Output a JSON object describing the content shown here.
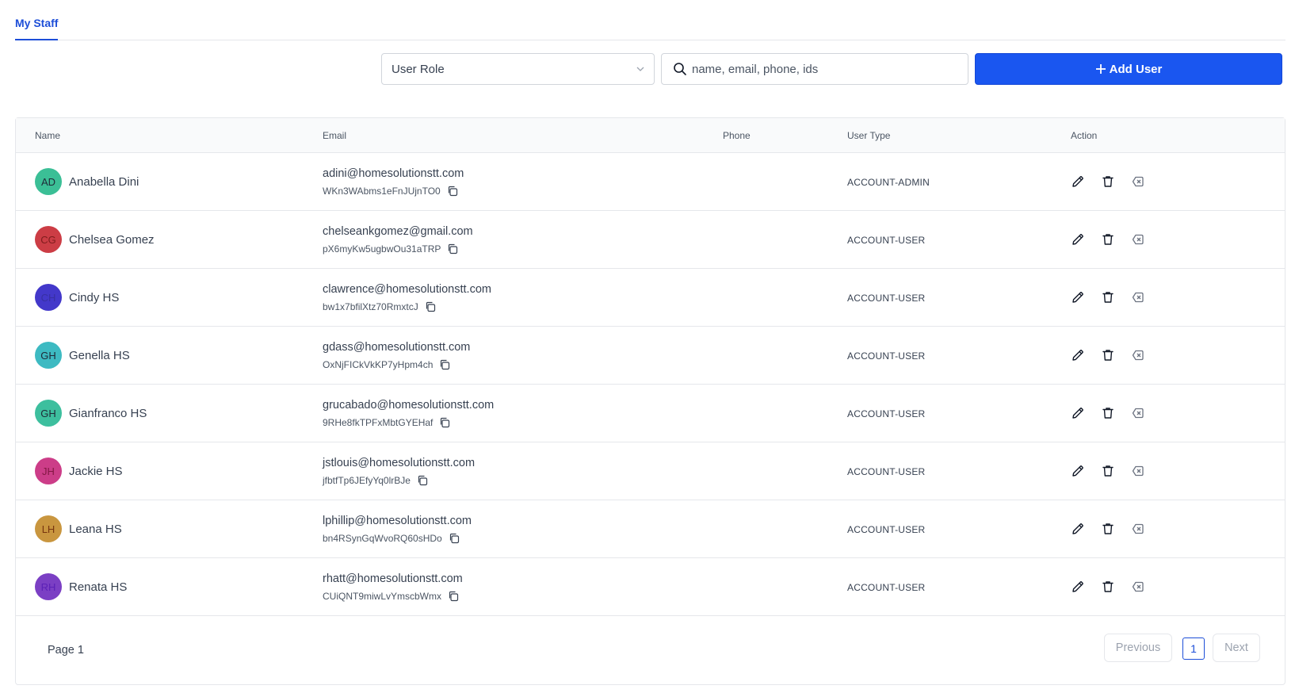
{
  "tabs": [
    {
      "label": "My Staff"
    }
  ],
  "filters": {
    "role_select": {
      "value": "User Role"
    },
    "search": {
      "placeholder": "name, email, phone, ids"
    },
    "add_button": {
      "label": "Add User"
    }
  },
  "table": {
    "headers": {
      "name": "Name",
      "email": "Email",
      "phone": "Phone",
      "user_type": "User Type",
      "action": "Action"
    },
    "rows": [
      {
        "initials": "AD",
        "avatar_color": "#3bbf96",
        "initials_color": "#1f2937",
        "name": "Anabella Dini",
        "email": "adini@homesolutionstt.com",
        "id": "WKn3WAbms1eFnJUjnTO0",
        "phone": "",
        "user_type": "ACCOUNT-ADMIN"
      },
      {
        "initials": "CG",
        "avatar_color": "#cc3d45",
        "initials_color": "#7f1d1d",
        "name": "Chelsea Gomez",
        "email": "chelseankgomez@gmail.com",
        "id": "pX6myKw5ugbwOu31aTRP",
        "phone": "",
        "user_type": "ACCOUNT-USER"
      },
      {
        "initials": "CH",
        "avatar_color": "#4338ca",
        "initials_color": "#3730a3",
        "name": "Cindy HS",
        "email": "clawrence@homesolutionstt.com",
        "id": "bw1x7bfilXtz70RmxtcJ",
        "phone": "",
        "user_type": "ACCOUNT-USER"
      },
      {
        "initials": "GH",
        "avatar_color": "#3dbac2",
        "initials_color": "#1f2937",
        "name": "Genella HS",
        "email": "gdass@homesolutionstt.com",
        "id": "OxNjFICkVkKP7yHpm4ch",
        "phone": "",
        "user_type": "ACCOUNT-USER"
      },
      {
        "initials": "GH",
        "avatar_color": "#3dbf9e",
        "initials_color": "#1f2937",
        "name": "Gianfranco HS",
        "email": "grucabado@homesolutionstt.com",
        "id": "9RHe8fkTPFxMbtGYEHaf",
        "phone": "",
        "user_type": "ACCOUNT-USER"
      },
      {
        "initials": "JH",
        "avatar_color": "#cc3d88",
        "initials_color": "#831843",
        "name": "Jackie HS",
        "email": "jstlouis@homesolutionstt.com",
        "id": "jfbtfTp6JEfyYq0lrBJe",
        "phone": "",
        "user_type": "ACCOUNT-USER"
      },
      {
        "initials": "LH",
        "avatar_color": "#c9963f",
        "initials_color": "#78350f",
        "name": "Leana HS",
        "email": "lphillip@homesolutionstt.com",
        "id": "bn4RSynGqWvoRQ60sHDo",
        "phone": "",
        "user_type": "ACCOUNT-USER"
      },
      {
        "initials": "RH",
        "avatar_color": "#7b3fc4",
        "initials_color": "#5b21b6",
        "name": "Renata HS",
        "email": "rhatt@homesolutionstt.com",
        "id": "CUiQNT9miwLvYmscbWmx",
        "phone": "",
        "user_type": "ACCOUNT-USER"
      }
    ]
  },
  "pagination": {
    "page_label": "Page 1",
    "previous": "Previous",
    "current": "1",
    "next": "Next"
  },
  "icons": {
    "search": "search-icon",
    "chevron": "chevron-down-icon",
    "add": "plus-icon",
    "copy": "copy-icon",
    "edit": "pencil-icon",
    "delete": "trash-icon",
    "disable": "x-square-icon"
  },
  "colors": {
    "accent": "#1a56f0",
    "tab_active": "#1d4ed8"
  }
}
